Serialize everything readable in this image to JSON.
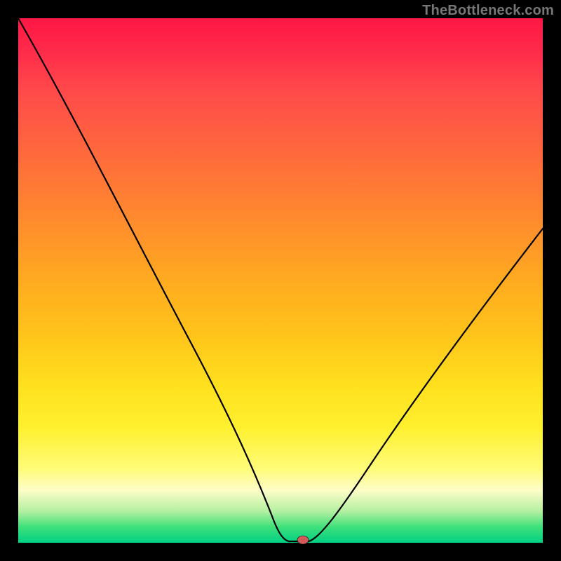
{
  "watermark": "TheBottleneck.com",
  "chart_data": {
    "type": "line",
    "title": "",
    "xlabel": "",
    "ylabel": "",
    "xlim": [
      0,
      100
    ],
    "ylim": [
      0,
      100
    ],
    "series": [
      {
        "name": "bottleneck-curve",
        "x": [
          0,
          6,
          12,
          18,
          24,
          30,
          36,
          42,
          47,
          50,
          53,
          55,
          60,
          66,
          72,
          78,
          84,
          90,
          96,
          100
        ],
        "y": [
          100,
          89,
          78,
          67,
          57,
          47,
          37,
          27,
          14,
          4,
          0,
          0,
          5,
          13,
          22,
          31,
          40,
          48,
          55,
          60
        ]
      }
    ],
    "marker": {
      "x": 54,
      "y": 0.5,
      "name": "optimal-point"
    },
    "background_gradient": {
      "top": "#ff1744",
      "mid_upper": "#ff8a2e",
      "mid": "#ffe01e",
      "mid_lower": "#fdfdc8",
      "bottom": "#00d084"
    }
  }
}
